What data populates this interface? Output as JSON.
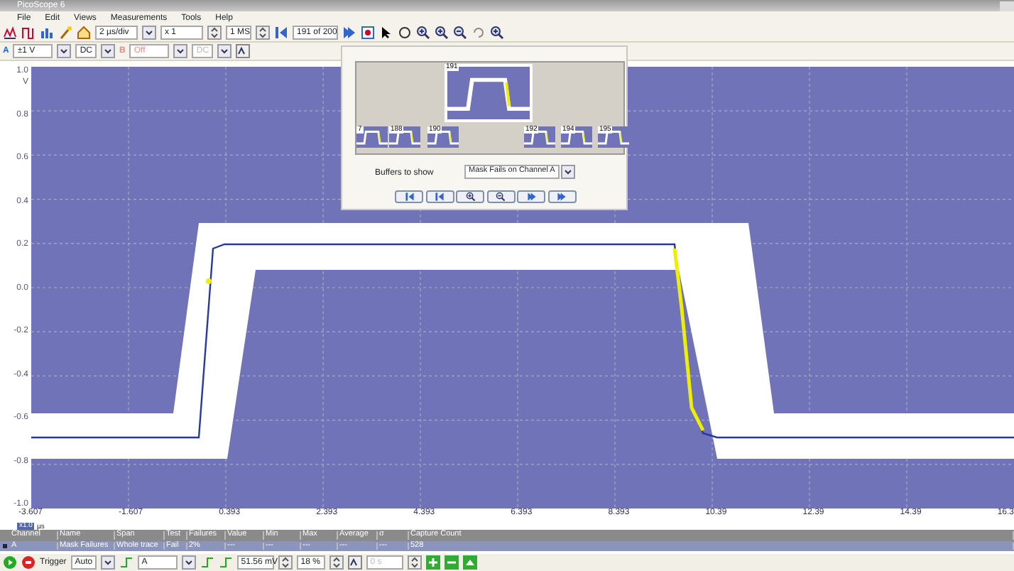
{
  "window": {
    "title": "PicoScope 6"
  },
  "menu": [
    "File",
    "Edit",
    "Views",
    "Measurements",
    "Tools",
    "Help"
  ],
  "toolbar": {
    "timebase": "2 µs/div",
    "zoom": "x 1",
    "samples": "1 MS",
    "buffer": "191 of 200"
  },
  "channel_bar": {
    "a_label": "A",
    "a_range": "±1 V",
    "a_coupling": "DC",
    "b_label": "B",
    "b_range": "Off",
    "b_coupling": "DC",
    "b_enabled": false
  },
  "scope": {
    "y_unit": "V",
    "y_ticks": [
      "1.0",
      "0.8",
      "0.6",
      "0.4",
      "0.2",
      "0.0",
      "-0.2",
      "-0.4",
      "-0.6",
      "-0.8",
      "-1.0"
    ],
    "x_ticks": [
      "-3.607",
      "-1.607",
      "0.393",
      "2.393",
      "4.393",
      "6.393",
      "8.393",
      "10.39",
      "12.39",
      "14.39",
      "16.3"
    ],
    "x_unit": "µs",
    "zoom_badge": "x1.0"
  },
  "measurements": {
    "columns": [
      "Channel",
      "Name",
      "Span",
      "Test",
      "Failures",
      "Value",
      "Min",
      "Max",
      "Average",
      "σ",
      "Capture Count"
    ],
    "rows": [
      [
        "A",
        "Mask Failures",
        "Whole trace",
        "Fail",
        "2%",
        "---",
        "---",
        "---",
        "---",
        "---",
        "528"
      ]
    ]
  },
  "buffer_navigator": {
    "current": "191",
    "thumbnails": [
      "7",
      "188",
      "190",
      "192",
      "194",
      "195"
    ],
    "label": "Buffers to show",
    "filter": "Mask Fails on Channel A"
  },
  "trigger_bar": {
    "label": "Trigger",
    "mode": "Auto",
    "source": "A",
    "threshold": "51.56 mV",
    "pretrigger": "18 %",
    "delay": "0 s",
    "delay_enabled": false
  }
}
